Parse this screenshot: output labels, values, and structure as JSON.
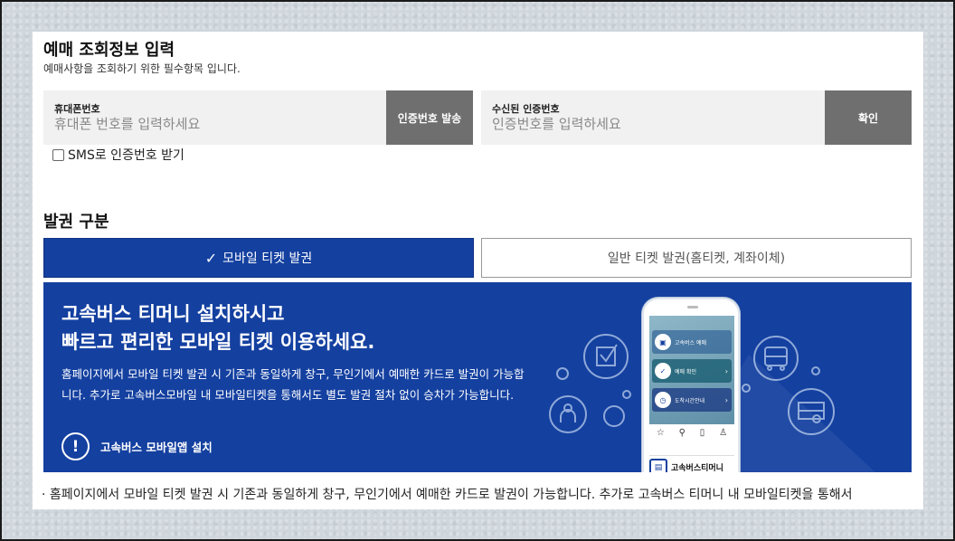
{
  "section1": {
    "title": "예매 조회정보 입력",
    "subtitle": "예매사항을 조회하기 위한 필수항목 입니다."
  },
  "phone_field": {
    "label": "휴대폰번호",
    "placeholder": "휴대폰 번호를 입력하세요",
    "button": "인증번호 발송"
  },
  "code_field": {
    "label": "수신된 인증번호",
    "placeholder": "인증번호를 입력하세요",
    "button": "확인"
  },
  "sms_option": {
    "label": "SMS로 인증번호 받기",
    "checked": false
  },
  "section2": {
    "title": "발권 구분"
  },
  "tabs": [
    {
      "check": "✓",
      "label": "모바일 티켓 발권",
      "selected": true
    },
    {
      "label": "일반 티켓 발권(홈티켓, 계좌이체)",
      "selected": false
    }
  ],
  "banner": {
    "headline_line1": "고속버스 티머니 설치하시고",
    "headline_line2": "빠르고 편리한 모바일 티켓 이용하세요.",
    "body": "홈페이지에서 모바일 티켓 발권 시 기존과 동일하게 창구, 무인기에서 예매한 카드로 발권이 가능합니다. 추가로 고속버스모바일 내 모바일티켓을 통해서도 별도 발권 절차 없이 승차가 가능합니다.",
    "install_icon": "!",
    "install_label": "고속버스 모바일앱 설치",
    "phone": {
      "menu": [
        "고속버스 예매",
        "예매 확인",
        "도착시간안내"
      ],
      "brand": "고속버스티머니"
    }
  },
  "note": "· 홈페이지에서 모바일 티켓 발권 시 기존과 동일하게 창구, 무인기에서 예매한 카드로 발권이 가능합니다. 추가로 고속버스 티머니 내 모바일티켓을 통해서",
  "colors": {
    "primary": "#1440a0",
    "button_gray": "#6f6f6f",
    "field_bg": "#f1f1f1"
  }
}
